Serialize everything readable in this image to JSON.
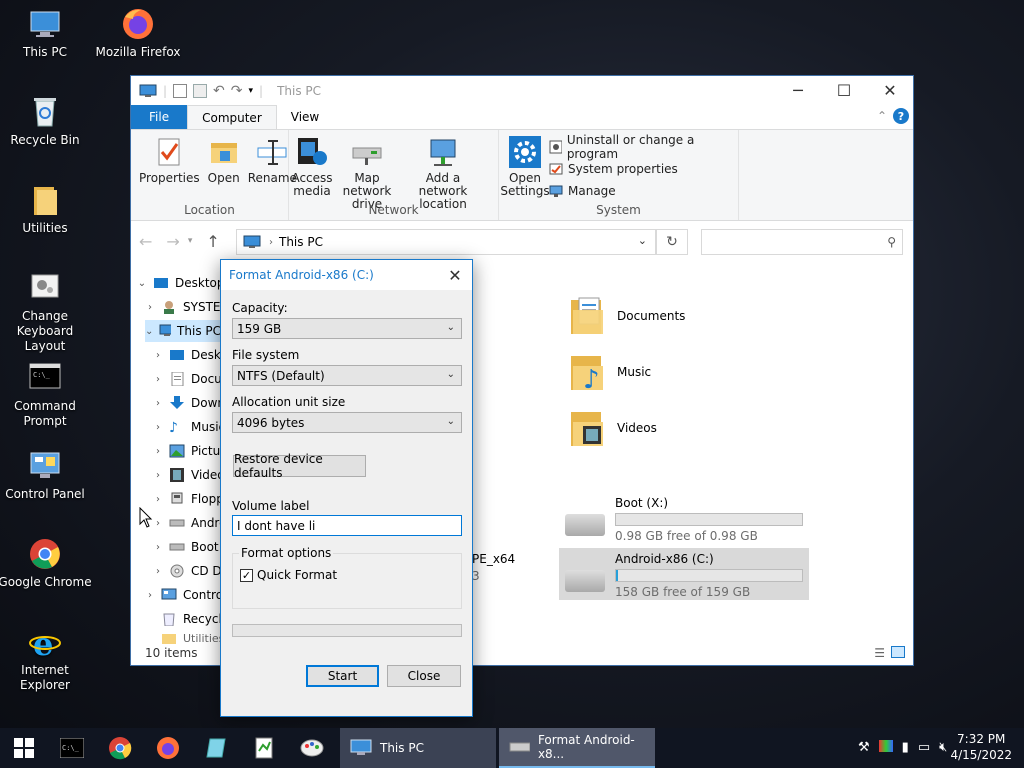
{
  "desktop": {
    "icons": [
      {
        "label": "This PC"
      },
      {
        "label": "Mozilla Firefox"
      },
      {
        "label": "Recycle Bin"
      },
      {
        "label": "Utilities"
      },
      {
        "label": "Change Keyboard Layout"
      },
      {
        "label": "Command Prompt"
      },
      {
        "label": "Control Panel"
      },
      {
        "label": "Google Chrome"
      },
      {
        "label": "Internet Explorer"
      }
    ]
  },
  "explorer": {
    "title": "This PC",
    "tabs": {
      "file": "File",
      "computer": "Computer",
      "view": "View"
    },
    "ribbon": {
      "location": {
        "label": "Location",
        "properties": "Properties",
        "open": "Open",
        "rename": "Rename"
      },
      "network": {
        "label": "Network",
        "access_media": "Access media",
        "map_drive": "Map network drive",
        "add_location": "Add a network location"
      },
      "system": {
        "label": "System",
        "open_settings": "Open Settings",
        "uninstall": "Uninstall or change a program",
        "sys_props": "System properties",
        "manage": "Manage"
      }
    },
    "address": "This PC",
    "nav": [
      "Desktop",
      "SYSTEM",
      "This PC",
      "Deskt",
      "Docu",
      "Down",
      "Music",
      "Pictur",
      "Video",
      "Flopp",
      "Andro",
      "Boot",
      "CD Dr",
      "Contro",
      "Recycle",
      "Utilities"
    ],
    "folders": [
      "Documents",
      "Music",
      "Videos"
    ],
    "drives": [
      {
        "name": "Boot (X:)",
        "free": "0.98 GB free of 0.98 GB",
        "used_fraction": 0.0
      },
      {
        "name": "Android-x86 (C:)",
        "free": "158 GB free of 159 GB",
        "used_fraction": 0.01
      }
    ],
    "partial_drive_text": "PE_x64",
    "partial_drive_sub": "3",
    "status_items": "10 items",
    "status_extra": "1"
  },
  "dialog": {
    "title": "Format Android-x86 (C:)",
    "capacity_label": "Capacity:",
    "capacity": "159 GB",
    "fs_label": "File system",
    "fs": "NTFS (Default)",
    "alloc_label": "Allocation unit size",
    "alloc": "4096 bytes",
    "restore": "Restore device defaults",
    "volume_label": "Volume label",
    "volume_value": "I dont have li",
    "options_label": "Format options",
    "quick_format": "Quick Format",
    "start": "Start",
    "close": "Close"
  },
  "taskbar": {
    "tasks": [
      {
        "label": "This PC"
      },
      {
        "label": "Format Android-x8..."
      }
    ],
    "time": "7:32 PM",
    "date": "4/15/2022"
  },
  "colors": {
    "accent": "#1979ca",
    "taskbar": "#101521",
    "selection": "#cce8ff",
    "drive_bar": "#26a0da"
  }
}
